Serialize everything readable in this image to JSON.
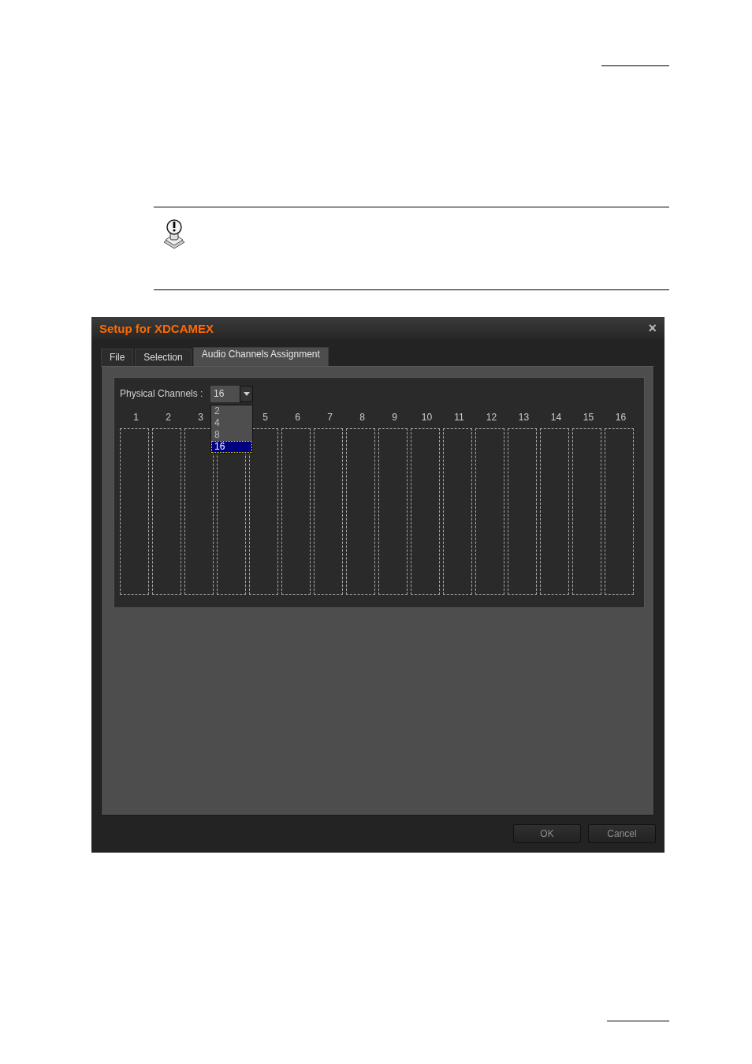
{
  "dialog": {
    "title": "Setup for XDCAMEX",
    "close": "×",
    "tabs": [
      {
        "label": "File",
        "selected": false
      },
      {
        "label": "Selection",
        "selected": false
      },
      {
        "label": "Audio Channels Assignment",
        "selected": true
      }
    ],
    "physical_channels": {
      "label": "Physical Channels :",
      "value": "16",
      "expanded": true,
      "options": [
        {
          "label": "2",
          "selected": false
        },
        {
          "label": "4",
          "selected": false
        },
        {
          "label": "8",
          "selected": false
        },
        {
          "label": "16",
          "selected": true
        }
      ]
    },
    "channels": [
      {
        "number": "1"
      },
      {
        "number": "2"
      },
      {
        "number": "3"
      },
      {
        "kind": "covered"
      },
      {
        "number": "5"
      },
      {
        "number": "6"
      },
      {
        "number": "7"
      },
      {
        "number": "8"
      },
      {
        "number": "9"
      },
      {
        "number": "10"
      },
      {
        "number": "11"
      },
      {
        "number": "12"
      },
      {
        "number": "13"
      },
      {
        "number": "14"
      },
      {
        "number": "15"
      },
      {
        "number": "16"
      }
    ],
    "buttons": [
      "OK",
      "Cancel"
    ]
  }
}
